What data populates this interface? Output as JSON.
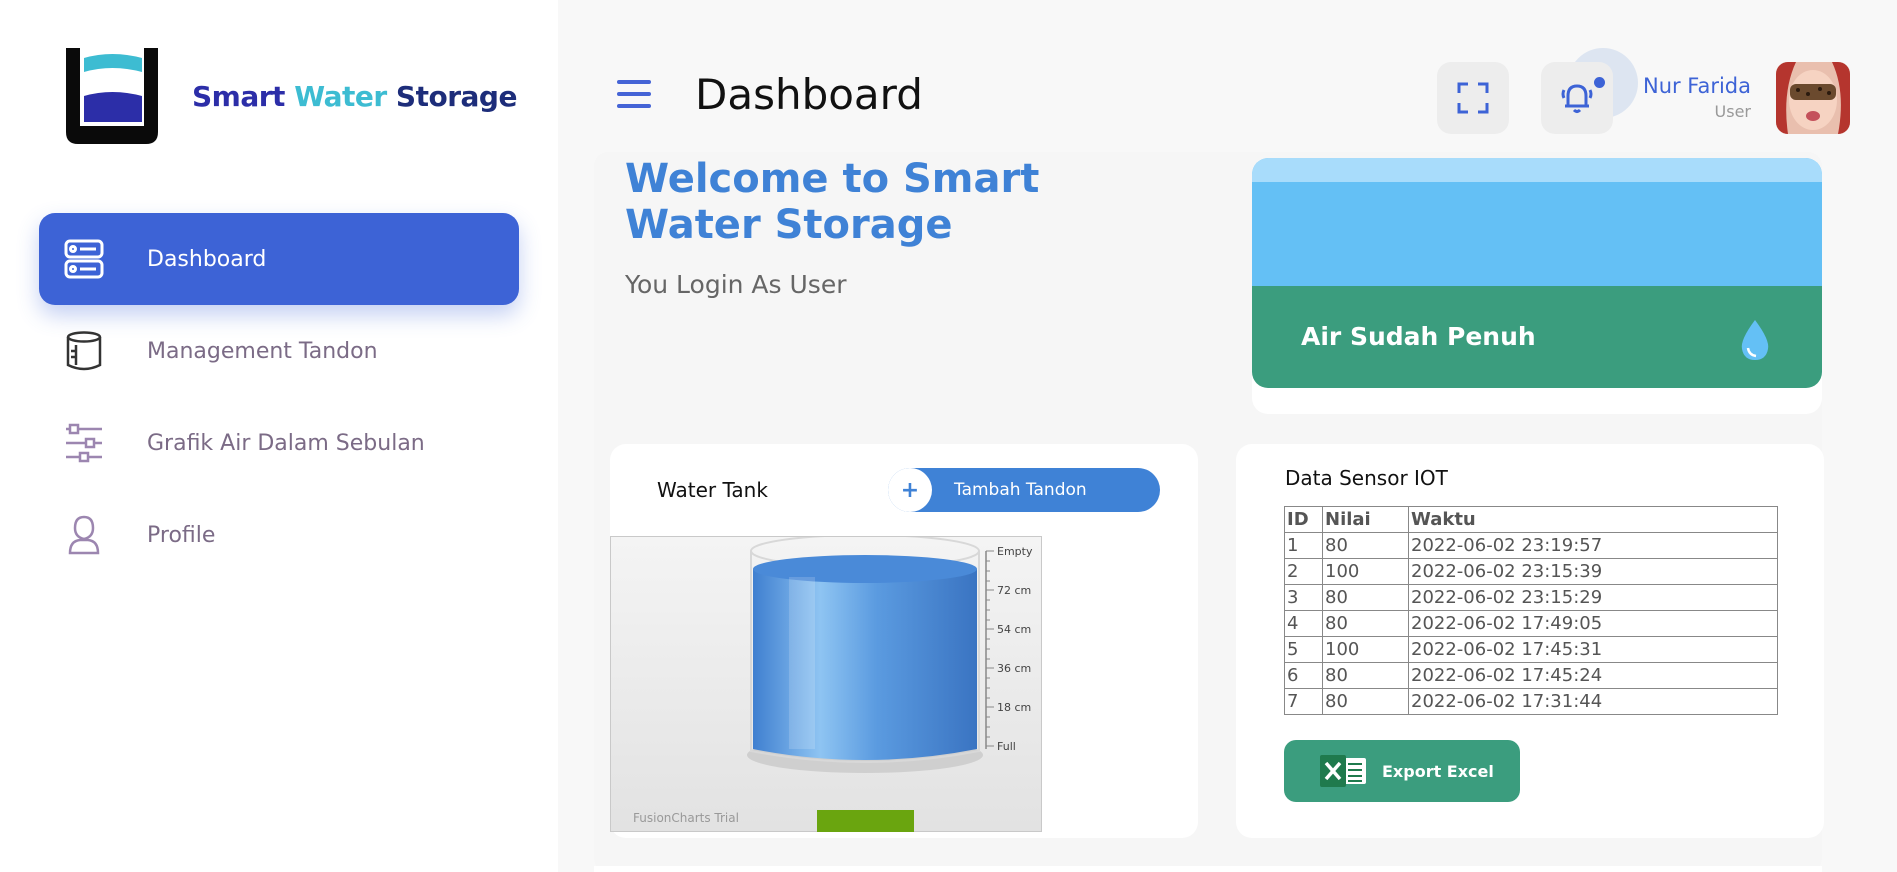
{
  "brand": {
    "word1": "Smart",
    "word2": "Water",
    "word3": "Storage",
    "colors": {
      "word1": "#2c2ea8",
      "word2": "#3dbcd2",
      "word3": "#1d2d7a"
    }
  },
  "sidebar": {
    "items": [
      {
        "label": "Dashboard",
        "icon": "server-icon",
        "active": true
      },
      {
        "label": "Management Tandon",
        "icon": "cylinder-icon",
        "active": false
      },
      {
        "label": "Grafik Air Dalam Sebulan",
        "icon": "sliders-icon",
        "active": false
      },
      {
        "label": "Profile",
        "icon": "user-icon",
        "active": false
      }
    ]
  },
  "header": {
    "title": "Dashboard",
    "user": {
      "name": "Nur Farida",
      "role": "User"
    }
  },
  "welcome": {
    "title": "Welcome to Smart Water Storage",
    "subtitle": "You Login As User"
  },
  "status": {
    "text": "Air Sudah Penuh",
    "colors": {
      "water": "#64c0f5",
      "bar": "#3b9d7e"
    }
  },
  "tank": {
    "title": "Water Tank",
    "add_button": "Tambah Tandon",
    "scale_labels": [
      "Empty",
      "72 cm",
      "54 cm",
      "36 cm",
      "18 cm",
      "Full"
    ],
    "watermark": "FusionCharts Trial"
  },
  "sensor": {
    "title": "Data Sensor IOT",
    "columns": [
      "ID",
      "Nilai",
      "Waktu"
    ],
    "rows": [
      [
        "1",
        "80",
        "2022-06-02 23:19:57"
      ],
      [
        "2",
        "100",
        "2022-06-02 23:15:39"
      ],
      [
        "3",
        "80",
        "2022-06-02 23:15:29"
      ],
      [
        "4",
        "80",
        "2022-06-02 17:49:05"
      ],
      [
        "5",
        "100",
        "2022-06-02 17:45:31"
      ],
      [
        "6",
        "80",
        "2022-06-02 17:45:24"
      ],
      [
        "7",
        "80",
        "2022-06-02 17:31:44"
      ]
    ],
    "export_button": "Export Excel"
  },
  "accent_color": "#3d63d6"
}
